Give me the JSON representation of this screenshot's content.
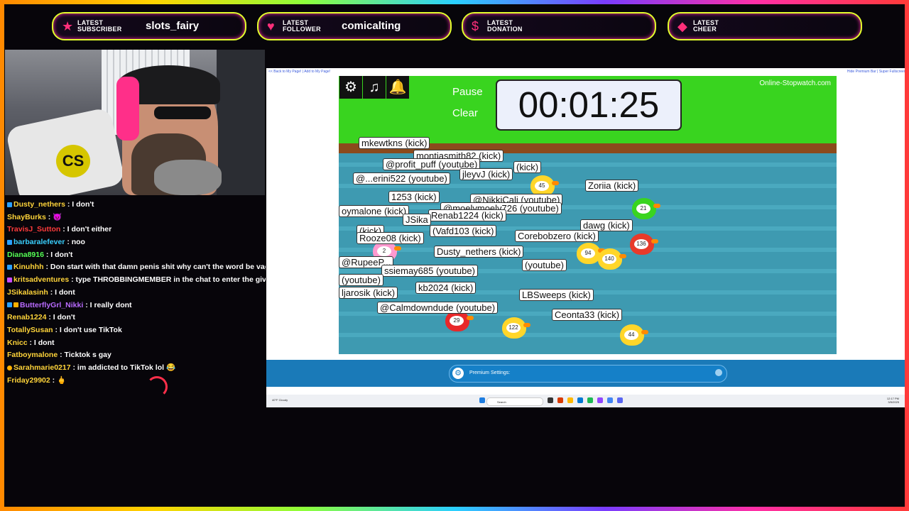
{
  "alerts": [
    {
      "kind": "LATEST SUBSCRIBER",
      "name": "slots_fairy",
      "icon": "star-icon"
    },
    {
      "kind": "LATEST FOLLOWER",
      "name": "comicalting",
      "icon": "heart-icon"
    },
    {
      "kind": "LATEST DONATION",
      "name": "",
      "icon": "dollar-icon"
    },
    {
      "kind": "LATEST CHEER",
      "name": "",
      "icon": "diamond-icon"
    }
  ],
  "webcam": {
    "pillow_logo": "CS"
  },
  "chat": [
    {
      "user": "Dusty_nethers",
      "msg": ": I don't",
      "color": "#ffd43a"
    },
    {
      "user": "ShayBurks",
      "msg": ": 😈",
      "color": "#ffd43a"
    },
    {
      "user": "TravisJ_Sutton",
      "msg": ": I don't either",
      "color": "#ff3b3b"
    },
    {
      "user": "barbaralefever",
      "msg": ": noo",
      "color": "#3ad0ff"
    },
    {
      "user": "Diana8916",
      "msg": ": I don't",
      "color": "#55ff55"
    },
    {
      "user": "Kinuhhh",
      "msg": ": Don start with that damn penis shit why can't the word be vagina?",
      "color": "#ffd43a"
    },
    {
      "user": "kritsadventures",
      "msg": ": type THROBBINGMEMBER in the chat to enter the giveaway",
      "color": "#ffd43a"
    },
    {
      "user": "JSikalasinh",
      "msg": ": I dont",
      "color": "#ffd43a"
    },
    {
      "user": "ButterflyGrl_Nikki",
      "msg": ": I really dont",
      "color": "#b96bff"
    },
    {
      "user": "Renab1224",
      "msg": ": I don't",
      "color": "#ffd43a"
    },
    {
      "user": "TotallySusan",
      "msg": ": I don't use TikTok",
      "color": "#ffd43a"
    },
    {
      "user": "Knicc",
      "msg": ": I dont",
      "color": "#ffd43a"
    },
    {
      "user": "Fatboymalone",
      "msg": ": Ticktok s gay",
      "color": "#ffd43a"
    },
    {
      "user": "Sarahmarie0217",
      "msg": ": im addicted to TikTok lol 😂",
      "color": "#ffd43a"
    },
    {
      "user": "Friday29902",
      "msg": ": 🖕",
      "color": "#ffd43a"
    }
  ],
  "browser": {
    "top_left_links": "<< Back to My Page! | Add to My Page!",
    "top_right_links": "Hide Premium Bar | Super Fullscreen!"
  },
  "game": {
    "pause": "Pause",
    "clear": "Clear",
    "timer": "00:01:25",
    "brand": "Online-Stopwatch.com",
    "names": [
      "mkewtkns (kick)",
      "montiasmith82 (kick)",
      "@profit_puff (youtube)",
      "(kick)",
      "jleyvJ (kick)",
      "@...erini522 (youtube)",
      "1253 (kick)",
      "@NikkiCali (youtube)",
      "Zoriia (kick)",
      "oymalone (kick)",
      "@moelymoely726 (youtube)",
      "Renab1224 (kick)",
      "JSika",
      "dawg (kick)",
      "(kick)",
      "(Vafd103 (kick)",
      "Corebobzero (kick)",
      "Rooze08 (kick)",
      "Dusty_nethers (kick)",
      "@RupeeP...",
      "(youtube)",
      "ssiemay685 (youtube)",
      "(youtube)",
      "ljarosik (kick)",
      "kb2024 (kick)",
      "LBSweeps (kick)",
      "@Calmdowndude (youtube)",
      "Ceonta33 (kick)"
    ],
    "duck_numbers": [
      "45",
      "21",
      "94",
      "140",
      "136",
      "2",
      "29",
      "122",
      "44"
    ]
  },
  "premium": {
    "label": "Premium Settings:"
  },
  "taskbar": {
    "weather_temp": "40°F",
    "weather_desc": "Cloudy",
    "search": "Search",
    "time": "12:17 PM",
    "date": "3/5/2025"
  }
}
